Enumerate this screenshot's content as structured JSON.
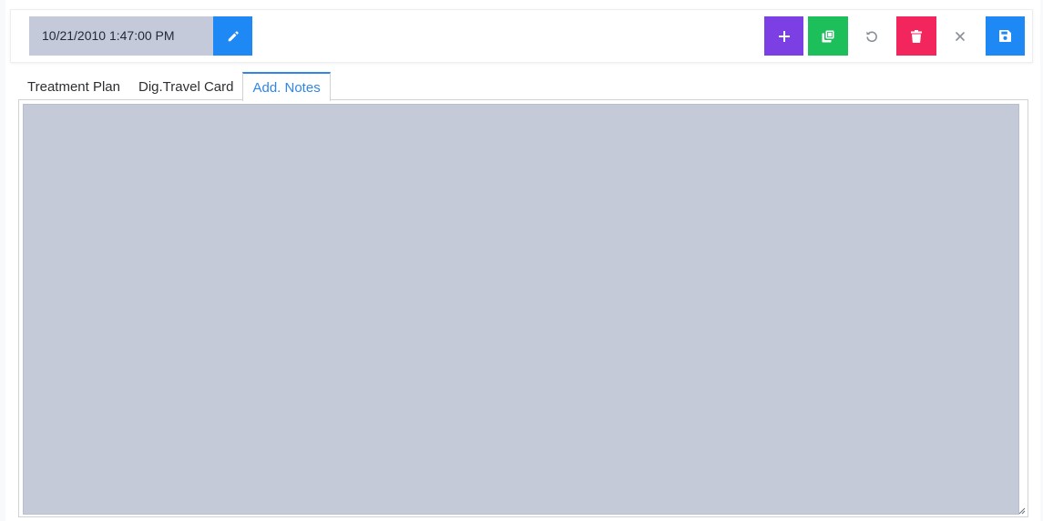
{
  "toolbar": {
    "date_value": "10/21/2010 1:47:00 PM",
    "buttons": {
      "edit": {
        "icon": "pencil-icon",
        "color": "#1e88f5"
      },
      "add": {
        "icon": "plus-icon",
        "color": "#7b3fe4"
      },
      "duplicate": {
        "icon": "copy-icon",
        "color": "#1dbf5b"
      },
      "undo": {
        "icon": "undo-icon"
      },
      "delete": {
        "icon": "trash-icon",
        "color": "#f2255d"
      },
      "close": {
        "icon": "close-icon"
      },
      "save": {
        "icon": "save-icon",
        "color": "#1e88f5"
      }
    }
  },
  "tabs": [
    {
      "label": "Treatment Plan",
      "active": false
    },
    {
      "label": "Dig.Travel Card",
      "active": false
    },
    {
      "label": "Add. Notes",
      "active": true
    }
  ],
  "notes": {
    "value": ""
  },
  "colors": {
    "accent": "#2f86e8",
    "notes_bg": "#c5cad9"
  }
}
